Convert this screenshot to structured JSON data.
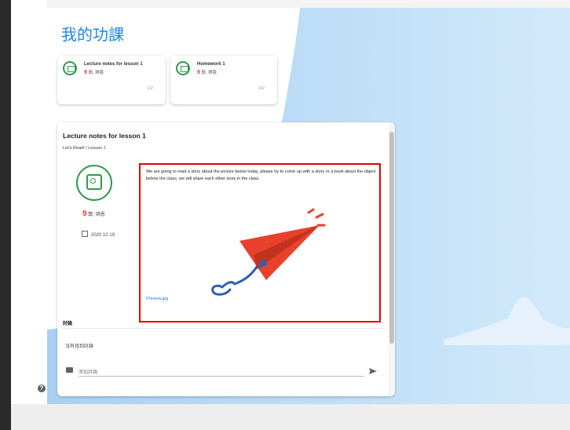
{
  "page": {
    "title": "我的功課"
  },
  "assignments": [
    {
      "title": "Lecture notes for lesson 1",
      "author": "鄭, 琪恩",
      "progress": "1/2",
      "icon": "notes-icon"
    },
    {
      "title": "Homework 1",
      "author": "鄭, 琪恩",
      "progress": "2/2",
      "icon": "homework-icon"
    }
  ],
  "detail": {
    "title": "Lecture notes for lesson 1",
    "breadcrumb": "Let's Read! / Lesson 1",
    "author": "鄭, 琪恩",
    "date": "2020 10 19",
    "description": "We are going to read a story about the picture below today, please try to come up with a story or a book about the object before the class, we will share each other story in the class.",
    "attachment": "Preview.jpg"
  },
  "comments": {
    "heading": "討論",
    "empty": "沒有找到討論",
    "placeholder": "添加討論"
  },
  "colors": {
    "accent": "#1e88e5",
    "green": "#2e9b4c",
    "highlight": "#e00000",
    "plane": "#e8412c",
    "trail": "#2f5fb3"
  }
}
